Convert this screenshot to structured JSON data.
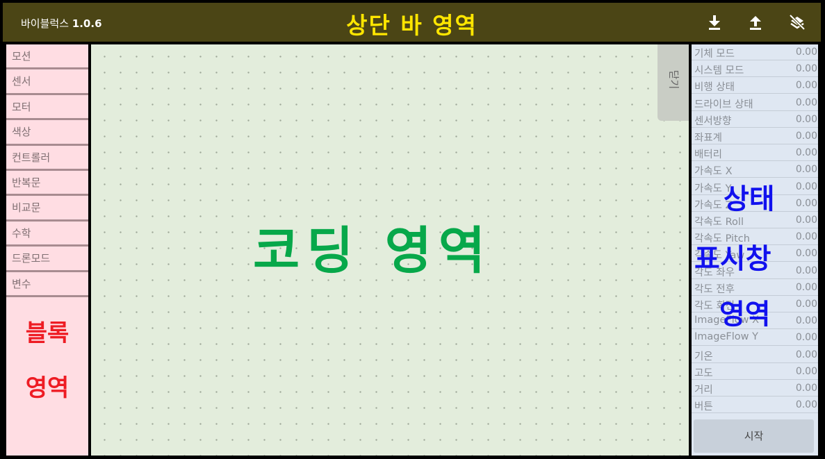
{
  "topbar": {
    "app_name": "바이블럭스",
    "version": "1.0.6",
    "overlay_label": "상단 바 영역",
    "icons": [
      "download-icon",
      "upload-icon",
      "disconnect-icon"
    ]
  },
  "sidebar": {
    "items": [
      {
        "label": "모션"
      },
      {
        "label": "센서"
      },
      {
        "label": "모터"
      },
      {
        "label": "색상"
      },
      {
        "label": "컨트롤러"
      },
      {
        "label": "반복문"
      },
      {
        "label": "비교문"
      },
      {
        "label": "수학"
      },
      {
        "label": "드론모드"
      },
      {
        "label": "변수"
      }
    ],
    "overlay_line1": "블록",
    "overlay_line2": "영역"
  },
  "coding": {
    "close_label": "닫기",
    "overlay_label": "코딩 영역"
  },
  "status": {
    "rows": [
      {
        "label": "기체 모드",
        "value": "0.00"
      },
      {
        "label": "시스템 모드",
        "value": "0.00"
      },
      {
        "label": "비행 상태",
        "value": "0.00"
      },
      {
        "label": "드라이브 상태",
        "value": "0.00"
      },
      {
        "label": "센서방향",
        "value": "0.00"
      },
      {
        "label": "좌표계",
        "value": "0.00"
      },
      {
        "label": "배터리",
        "value": "0.00"
      },
      {
        "label": "가속도 X",
        "value": "0.00"
      },
      {
        "label": "가속도 Y",
        "value": "0.00"
      },
      {
        "label": "가속도 Z",
        "value": "0.00"
      },
      {
        "label": "각속도 Roll",
        "value": "0.00"
      },
      {
        "label": "각속도 Pitch",
        "value": "0.00"
      },
      {
        "label": "각속도 Yaw",
        "value": "0.00"
      },
      {
        "label": "각도 좌우",
        "value": "0.00"
      },
      {
        "label": "각도 전후",
        "value": "0.00"
      },
      {
        "label": "각도 회전",
        "value": "0.00"
      },
      {
        "label": "ImageFlow X",
        "value": "0.00"
      },
      {
        "label": "ImageFlow Y",
        "value": "0.00"
      },
      {
        "label": "기온",
        "value": "0.00"
      },
      {
        "label": "고도",
        "value": "0.00"
      },
      {
        "label": "거리",
        "value": "0.00"
      },
      {
        "label": "버튼",
        "value": "0.00"
      }
    ],
    "start_label": "시작",
    "overlay_line1": "상태",
    "overlay_line2": "표시창",
    "overlay_line3": "영역"
  },
  "colors": {
    "topbar_bg": "#4b4515",
    "top_overlay": "#ffe600",
    "block_area_bg": "#ffdde3",
    "block_overlay": "#ee1c24",
    "coding_bg": "#e3eddc",
    "coding_overlay": "#07a84a",
    "status_bg": "#dfe7f2",
    "status_overlay": "#1111ee"
  }
}
